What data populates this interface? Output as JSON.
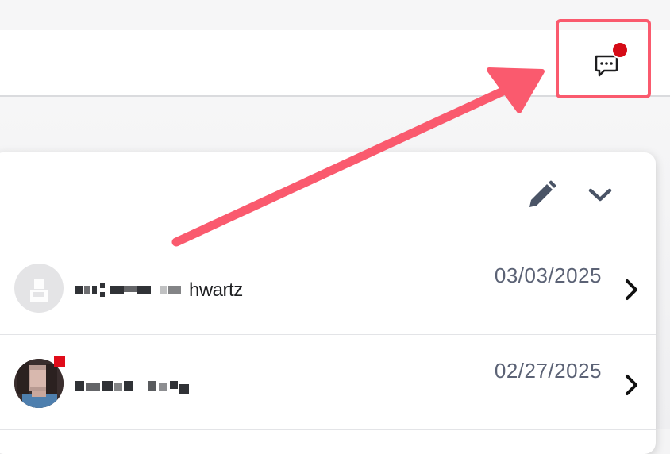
{
  "header": {
    "messages_button": {
      "icon": "chat-bubble-icon",
      "has_notification": true
    }
  },
  "panel": {
    "actions": [
      {
        "icon": "pencil-icon"
      },
      {
        "icon": "chevron-down-icon"
      }
    ],
    "conversations": [
      {
        "name_visible_part": "hwartz",
        "date": "03/03/2025"
      },
      {
        "name_visible_part": "",
        "date": "02/27/2025"
      }
    ]
  },
  "colors": {
    "annotation": "#fa5a6e",
    "notification_dot": "#d50b16",
    "date_text": "#5b6275",
    "icon": "#4a5466"
  }
}
